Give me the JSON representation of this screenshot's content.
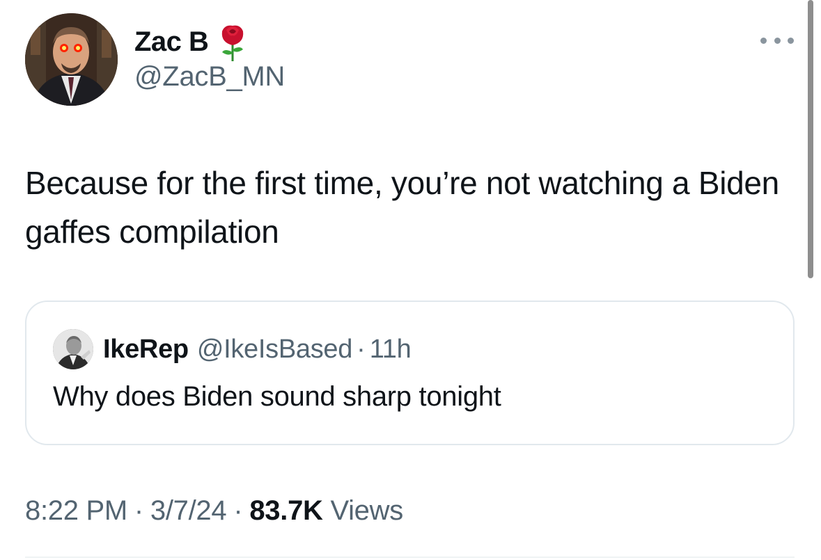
{
  "author": {
    "display_name": "Zac B",
    "handle": "@ZacB_MN",
    "badge_icon": "rose-emoji",
    "avatar_icon": "user-avatar"
  },
  "tweet": {
    "text": "Because for the first time, you’re not watching a Biden gaffes compilation"
  },
  "quoted_tweet": {
    "display_name": "IkeRep",
    "handle": "@IkeIsBased",
    "separator": "·",
    "time": "11h",
    "text": "Why does Biden sound sharp tonight"
  },
  "meta": {
    "time": "8:22 PM",
    "separator": "·",
    "date": "3/7/24",
    "views_count": "83.7K",
    "views_label": "Views"
  },
  "colors": {
    "text_primary": "#0f1419",
    "text_secondary": "#536471",
    "border": "#e1e8ed"
  }
}
